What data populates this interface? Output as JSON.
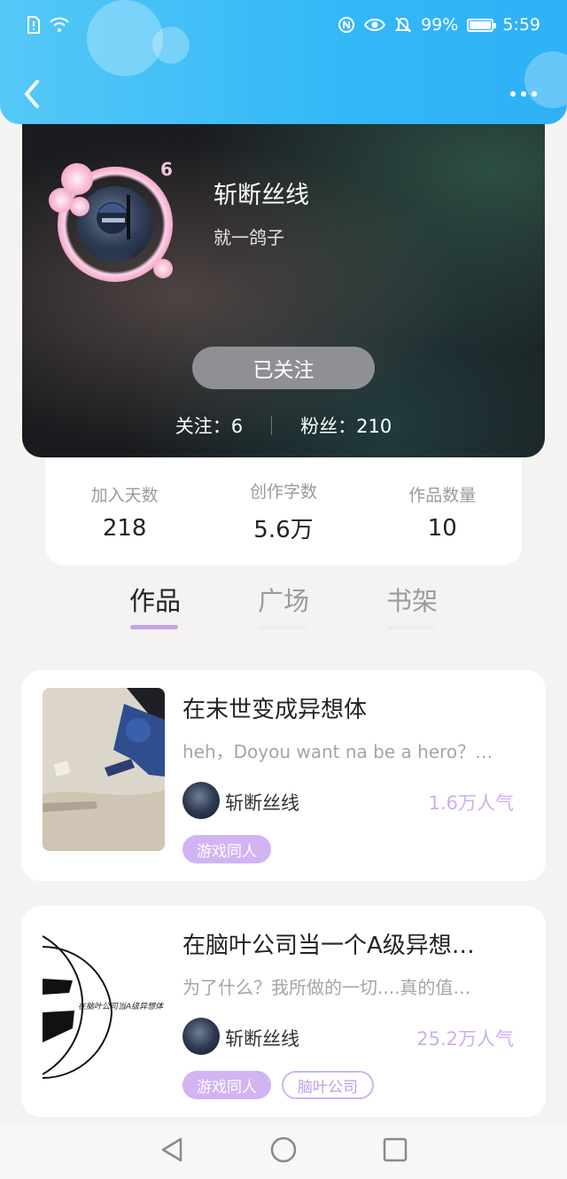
{
  "status_bar": {
    "battery_text": "99%",
    "battery_level": 0.99,
    "time": "5:59",
    "icons": [
      "sim-alert-icon",
      "wifi-icon",
      "nfc-icon",
      "eye-comfort-icon",
      "mute-icon"
    ]
  },
  "header": {
    "back_icon": "chevron-left-icon",
    "more_icon": "more-dots-icon",
    "color": "#33b8f7"
  },
  "profile": {
    "username": "斩断丝线",
    "motto": "就一鸽子",
    "level": "6",
    "follow_button": "已关注",
    "following_label": "关注：",
    "following_count": "6",
    "followers_label": "粉丝：",
    "followers_count": "210"
  },
  "stats": [
    {
      "label": "加入天数",
      "value": "218"
    },
    {
      "label": "创作字数",
      "value": "5.6万"
    },
    {
      "label": "作品数量",
      "value": "10"
    }
  ],
  "tabs": [
    {
      "label": "作品",
      "active": true
    },
    {
      "label": "广场",
      "active": false
    },
    {
      "label": "书架",
      "active": false
    }
  ],
  "works": [
    {
      "title": "在末世变成异想体",
      "description": "heh，Doyou want na be a hero？…",
      "author": "斩断丝线",
      "popularity": "1.6万人气",
      "tags": [
        "游戏同人"
      ]
    },
    {
      "title": "在脑叶公司当一个A级异想…",
      "description": "为了什么？我所做的一切....真的值…",
      "author": "斩断丝线",
      "popularity": "25.2万人气",
      "cover_text": "在脑叶公司当A级异想体",
      "tags": [
        "游戏同人",
        "脑叶公司"
      ]
    }
  ],
  "navbar": {
    "icons": [
      "back-triangle-icon",
      "home-circle-icon",
      "recents-square-icon"
    ]
  },
  "colors": {
    "accent": "#c7a2ec",
    "tag_fill": "#d2b3f3",
    "popularity": "#cdaef0",
    "background": "#f4f3f1"
  }
}
